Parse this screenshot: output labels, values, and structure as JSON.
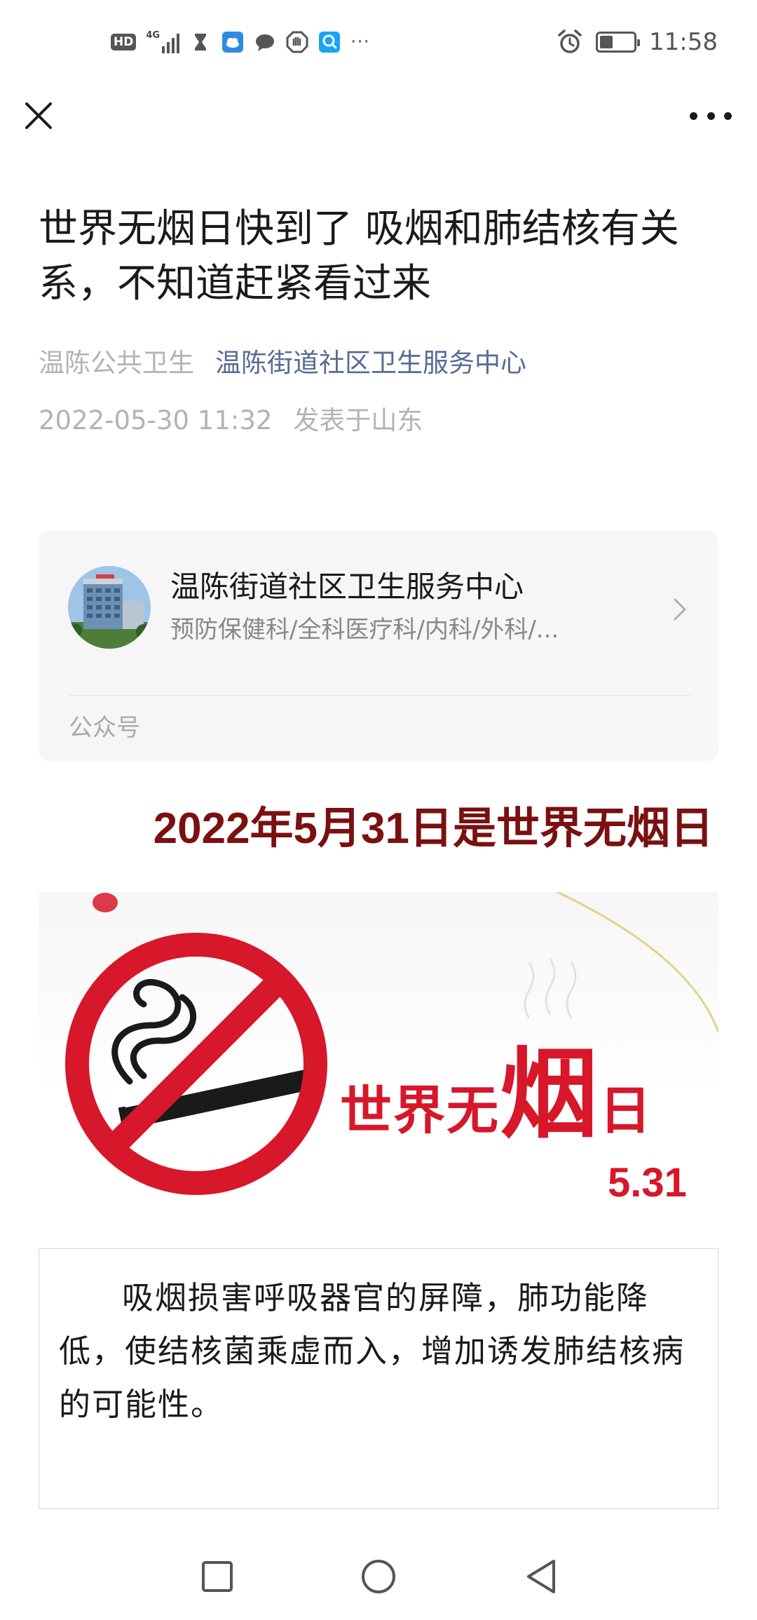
{
  "status_bar": {
    "hd_label": "HD",
    "network_label": "4G",
    "more": "···",
    "time": "11:58",
    "icons": [
      "hd-icon",
      "signal-icon",
      "hourglass-icon",
      "weather-app-icon",
      "chat-bubble-icon",
      "hand-icon",
      "search-app-icon",
      "alarm-icon",
      "battery-icon"
    ],
    "battery_level": 0.35
  },
  "nav": {
    "close_icon": "close-icon",
    "more_icon": "more-dots-icon"
  },
  "article": {
    "title": "世界无烟日快到了 吸烟和肺结核有关系，不知道赶紧看过来",
    "author": "温陈公共卫生",
    "account": "温陈街道社区卫生服务中心",
    "date": "2022-05-30 11:32",
    "location": "发表于山东"
  },
  "account_card": {
    "name": "温陈街道社区卫生服务中心",
    "description": "预防保健科/全科医疗科/内科/外科/...",
    "tag": "公众号",
    "chevron_icon": "chevron-right-icon"
  },
  "body": {
    "headline": "2022年5月31日是世界无烟日",
    "headline_color": "#7a1010",
    "banner": {
      "title_part1": "世界无",
      "title_big": "烟",
      "title_part2": "日",
      "date": "5.31",
      "accent_color": "#d7172a"
    },
    "paragraph": "吸烟损害呼吸器官的屏障，肺功能降低，使结核菌乘虚而入，增加诱发肺结核病的可能性。"
  },
  "bottom_nav": {
    "icons": [
      "recent-apps-square-icon",
      "home-circle-icon",
      "back-triangle-icon"
    ]
  }
}
